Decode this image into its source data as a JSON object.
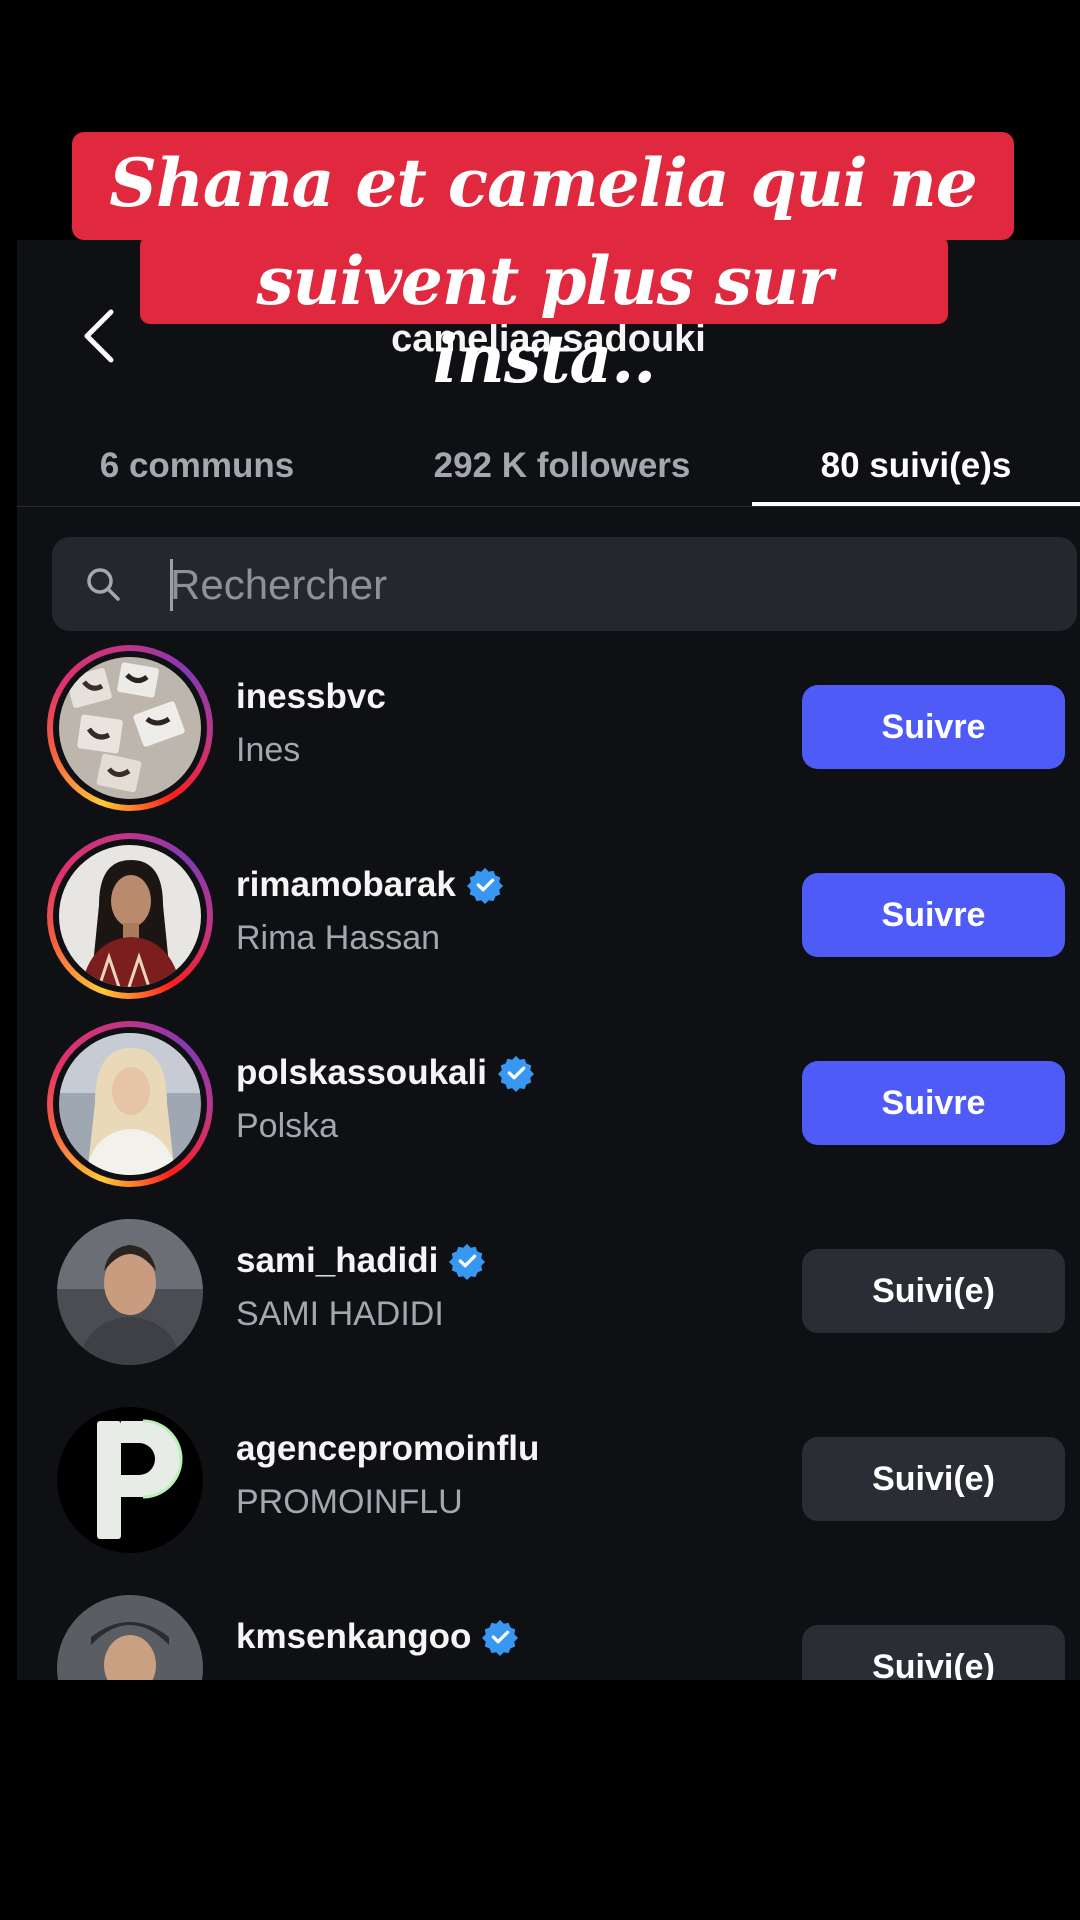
{
  "caption": {
    "line1": "Shana et camelia qui ne se",
    "line2": "suivent plus sur insta.."
  },
  "header": {
    "title": "cameliaa.sadouki",
    "back_icon": "chevron-left-icon"
  },
  "tabs": [
    {
      "label": "6 communs",
      "active": false
    },
    {
      "label": "292 K followers",
      "active": false
    },
    {
      "label": "80 suivi(e)s",
      "active": true
    }
  ],
  "search": {
    "placeholder": "Rechercher",
    "icon": "search-icon"
  },
  "accounts": [
    {
      "username": "inessbvc",
      "fullname": "Ines",
      "verified": false,
      "story": true,
      "button": "Suivre"
    },
    {
      "username": "rimamobarak",
      "fullname": "Rima Hassan",
      "verified": true,
      "story": true,
      "button": "Suivre"
    },
    {
      "username": "polskassoukali",
      "fullname": "Polska",
      "verified": true,
      "story": true,
      "button": "Suivre"
    },
    {
      "username": "sami_hadidi",
      "fullname": "SAMI HADIDI",
      "verified": true,
      "story": false,
      "button": "Suivi(e)"
    },
    {
      "username": "agencepromoinflu",
      "fullname": "PROMOINFLU",
      "verified": false,
      "story": false,
      "button": "Suivi(e)"
    },
    {
      "username": "kmsenkangoo",
      "fullname": "",
      "verified": true,
      "story": false,
      "button": "Suivi(e)"
    }
  ],
  "colors": {
    "follow_button": "#4f5bf7",
    "following_button": "#2a2d33",
    "caption_bg": "#e0293e",
    "verified": "#3897f0"
  }
}
